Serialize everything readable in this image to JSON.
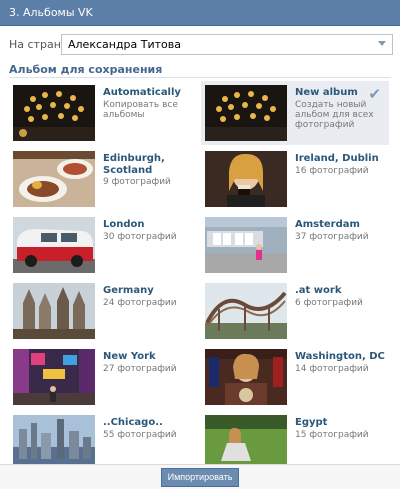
{
  "window": {
    "title": "3. Альбомы VK"
  },
  "page_selector": {
    "label": "На страницу:",
    "value": "Александра Титова"
  },
  "section": {
    "title": "Альбом для сохранения"
  },
  "albums": [
    {
      "name": "Automatically",
      "subtitle": "Копировать все альбомы"
    },
    {
      "name": "New album",
      "subtitle": "Создать новый альбом для всех фотографий"
    },
    {
      "name": "Edinburgh, Scotland",
      "subtitle": "9 фотографий"
    },
    {
      "name": "Ireland, Dublin",
      "subtitle": "16 фотографий"
    },
    {
      "name": "London",
      "subtitle": "30 фотографий"
    },
    {
      "name": "Amsterdam",
      "subtitle": "37 фотографий"
    },
    {
      "name": "Germany",
      "subtitle": "24 фотографии"
    },
    {
      "name": ".at work",
      "subtitle": "6 фотографий"
    },
    {
      "name": "New York",
      "subtitle": "27 фотографий"
    },
    {
      "name": "Washington, DC",
      "subtitle": "14 фотографий"
    },
    {
      "name": "..Chicago..",
      "subtitle": "55 фотографий"
    },
    {
      "name": "Egypt",
      "subtitle": "15 фотографий"
    }
  ],
  "footer": {
    "import_label": "Импортировать"
  }
}
